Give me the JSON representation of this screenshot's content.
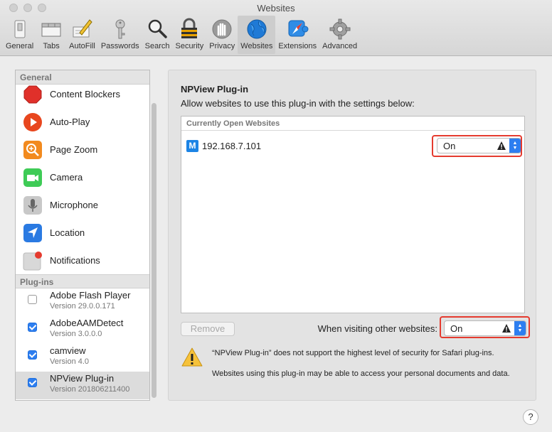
{
  "window": {
    "title": "Websites"
  },
  "toolbar": {
    "items": [
      {
        "label": "General",
        "icon": "switch-icon"
      },
      {
        "label": "Tabs",
        "icon": "tabs-icon"
      },
      {
        "label": "AutoFill",
        "icon": "pencil-form-icon"
      },
      {
        "label": "Passwords",
        "icon": "key-icon"
      },
      {
        "label": "Search",
        "icon": "magnifier-icon"
      },
      {
        "label": "Security",
        "icon": "padlock-icon"
      },
      {
        "label": "Privacy",
        "icon": "hand-icon"
      },
      {
        "label": "Websites",
        "icon": "globe-icon"
      },
      {
        "label": "Extensions",
        "icon": "puzzle-compass-icon"
      },
      {
        "label": "Advanced",
        "icon": "gear-icon"
      }
    ],
    "active": "Websites"
  },
  "sidebar": {
    "general_header": "General",
    "general_items": [
      {
        "label": "Content Blockers",
        "icon": "stop-sign-icon"
      },
      {
        "label": "Auto-Play",
        "icon": "play-icon"
      },
      {
        "label": "Page Zoom",
        "icon": "zoom-icon"
      },
      {
        "label": "Camera",
        "icon": "camera-icon"
      },
      {
        "label": "Microphone",
        "icon": "microphone-icon"
      },
      {
        "label": "Location",
        "icon": "location-arrow-icon"
      },
      {
        "label": "Notifications",
        "icon": "notification-badge-icon"
      }
    ],
    "plugins_header": "Plug-ins",
    "plugins": [
      {
        "name": "Adobe Flash Player",
        "version": "Version 29.0.0.171",
        "checked": false
      },
      {
        "name": "AdobeAAMDetect",
        "version": "Version 3.0.0.0",
        "checked": true
      },
      {
        "name": "camview",
        "version": "Version 4.0",
        "checked": true
      },
      {
        "name": "NPView Plug-in",
        "version": "Version 201806211400",
        "checked": true
      }
    ]
  },
  "panel": {
    "title": "NPView Plug-in",
    "description": "Allow websites to use this plug-in with the settings below:",
    "table_header": "Currently Open Websites",
    "site": {
      "name": "192.168.7.101",
      "icon_letter": "M",
      "setting": "On"
    },
    "remove_label": "Remove",
    "other_label": "When visiting other websites:",
    "other_setting": "On",
    "warning_line1": "“NPView Plug-in” does not support the highest level of security for Safari plug-ins.",
    "warning_line2": "Websites using this plug-in may be able to access your personal documents and data."
  },
  "help_label": "?",
  "colors": {
    "accent": "#2d7ef0",
    "highlight": "#e53b2f"
  }
}
